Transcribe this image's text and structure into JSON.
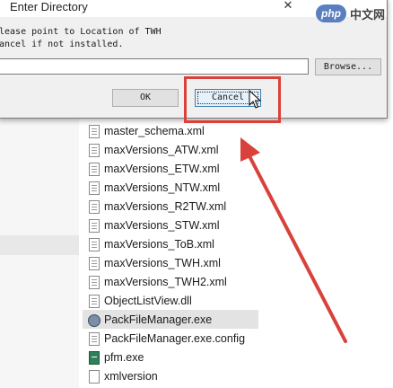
{
  "dialog": {
    "title": "Enter Directory",
    "prompt_line1": "lease point to Location of TWH",
    "prompt_line2": "ancel if not installed.",
    "path_value": "",
    "browse_label": "Browse...",
    "ok_label": "OK",
    "cancel_label": "Cancel",
    "close_glyph": "✕"
  },
  "files": [
    {
      "name": "master_schema.xml",
      "icon": "xml-file-icon"
    },
    {
      "name": "maxVersions_ATW.xml",
      "icon": "xml-file-icon"
    },
    {
      "name": "maxVersions_ETW.xml",
      "icon": "xml-file-icon"
    },
    {
      "name": "maxVersions_NTW.xml",
      "icon": "xml-file-icon"
    },
    {
      "name": "maxVersions_R2TW.xml",
      "icon": "xml-file-icon"
    },
    {
      "name": "maxVersions_STW.xml",
      "icon": "xml-file-icon"
    },
    {
      "name": "maxVersions_ToB.xml",
      "icon": "xml-file-icon"
    },
    {
      "name": "maxVersions_TWH.xml",
      "icon": "xml-file-icon"
    },
    {
      "name": "maxVersions_TWH2.xml",
      "icon": "xml-file-icon"
    },
    {
      "name": "ObjectListView.dll",
      "icon": "dll-file-icon"
    },
    {
      "name": "PackFileManager.exe",
      "icon": "gear-exe-icon"
    },
    {
      "name": "PackFileManager.exe.config",
      "icon": "config-file-icon"
    },
    {
      "name": "pfm.exe",
      "icon": "exe-file-icon"
    },
    {
      "name": "xmlversion",
      "icon": "blank-file-icon"
    }
  ],
  "selected_file": "PackFileManager.exe",
  "watermark": {
    "badge": "php",
    "text": "中文网"
  },
  "colors": {
    "highlight": "#d9413a",
    "arrow": "#d9413a"
  }
}
